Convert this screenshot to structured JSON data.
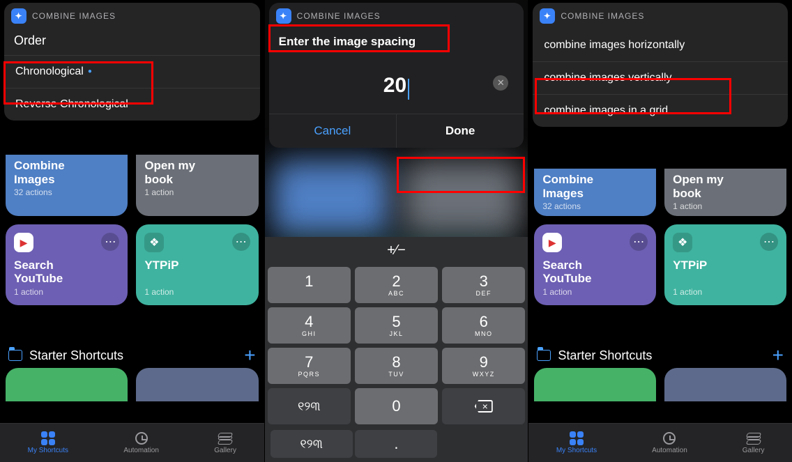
{
  "headerBadge": "✦",
  "headerTitle": "COMBINE IMAGES",
  "panel1": {
    "title": "Order",
    "opt1": "Chronological",
    "opt2": "Reverse Chronological"
  },
  "panel2": {
    "title": "Enter the image spacing",
    "value": "20",
    "cancel": "Cancel",
    "done": "Done"
  },
  "panel3": {
    "opt1": "combine images horizontally",
    "opt2": "combine images vertically",
    "opt3": "combine images in a grid"
  },
  "cards": {
    "combine": {
      "t1": "Combine",
      "t2": "Images",
      "sub": "32 actions"
    },
    "open": {
      "t1": "Open my",
      "t2": "book",
      "sub": "1 action"
    },
    "search": {
      "t1": "Search",
      "t2": "YouTube",
      "sub": "1 action"
    },
    "ytpip": {
      "t1": "YTPiP",
      "t2": "",
      "sub": "1 action"
    }
  },
  "folder": "Starter Shortcuts",
  "tabs": {
    "a": "My Shortcuts",
    "b": "Automation",
    "c": "Gallery"
  },
  "keypad": {
    "pm": "+⁄−",
    "k1": "1",
    "k2": "2",
    "k2l": "ABC",
    "k3": "3",
    "k3l": "DEF",
    "k4": "4",
    "k4l": "GHI",
    "k5": "5",
    "k5l": "JKL",
    "k6": "6",
    "k6l": "MNO",
    "k7": "7",
    "k7l": "PQRS",
    "k8": "8",
    "k8l": "TUV",
    "k9": "9",
    "k9l": "WXYZ",
    "alt": "୧୨୩",
    "dot": ".",
    "k0": "0"
  }
}
